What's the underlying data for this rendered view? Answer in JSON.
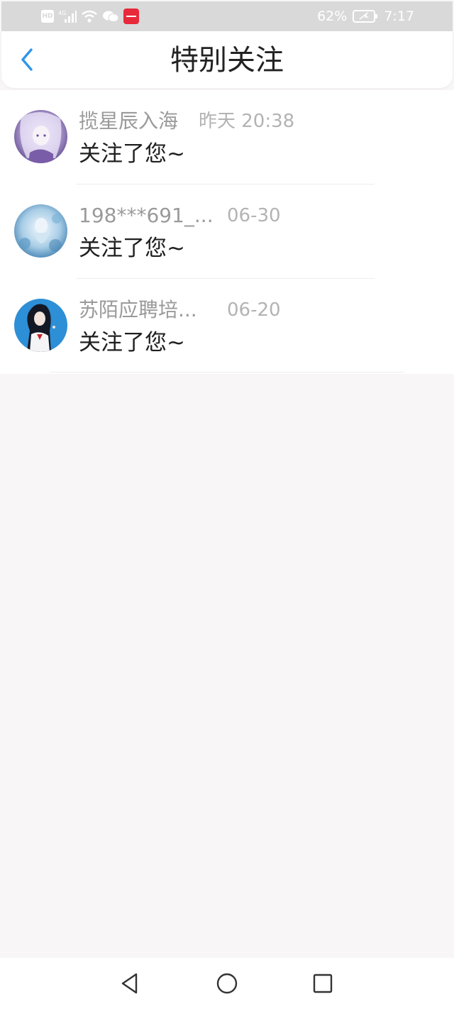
{
  "status_bar": {
    "hd_label": "HD",
    "network_label": "4G",
    "battery_percent": "62%",
    "time": "7:17",
    "icons": [
      "hd-icon",
      "signal-icon",
      "wifi-icon",
      "wechat-icon",
      "app-notification-icon",
      "battery-icon"
    ]
  },
  "header": {
    "title": "特别关注",
    "back_icon": "chevron-left-icon",
    "accent_color": "#2f96e8"
  },
  "items": [
    {
      "name": "揽星辰入海",
      "time": "昨天 20:38",
      "action": "关注了您~",
      "avatar": "anime-girl-purple-avatar"
    },
    {
      "name": "198***691_...",
      "time": "06-30",
      "action": "关注了您~",
      "avatar": "ice-blue-avatar"
    },
    {
      "name": "苏陌应聘培...",
      "time": "06-20",
      "action": "关注了您~",
      "avatar": "girl-blue-background-avatar"
    }
  ],
  "nav": {
    "icons": [
      "back-triangle-icon",
      "home-circle-icon",
      "recents-square-icon"
    ]
  }
}
